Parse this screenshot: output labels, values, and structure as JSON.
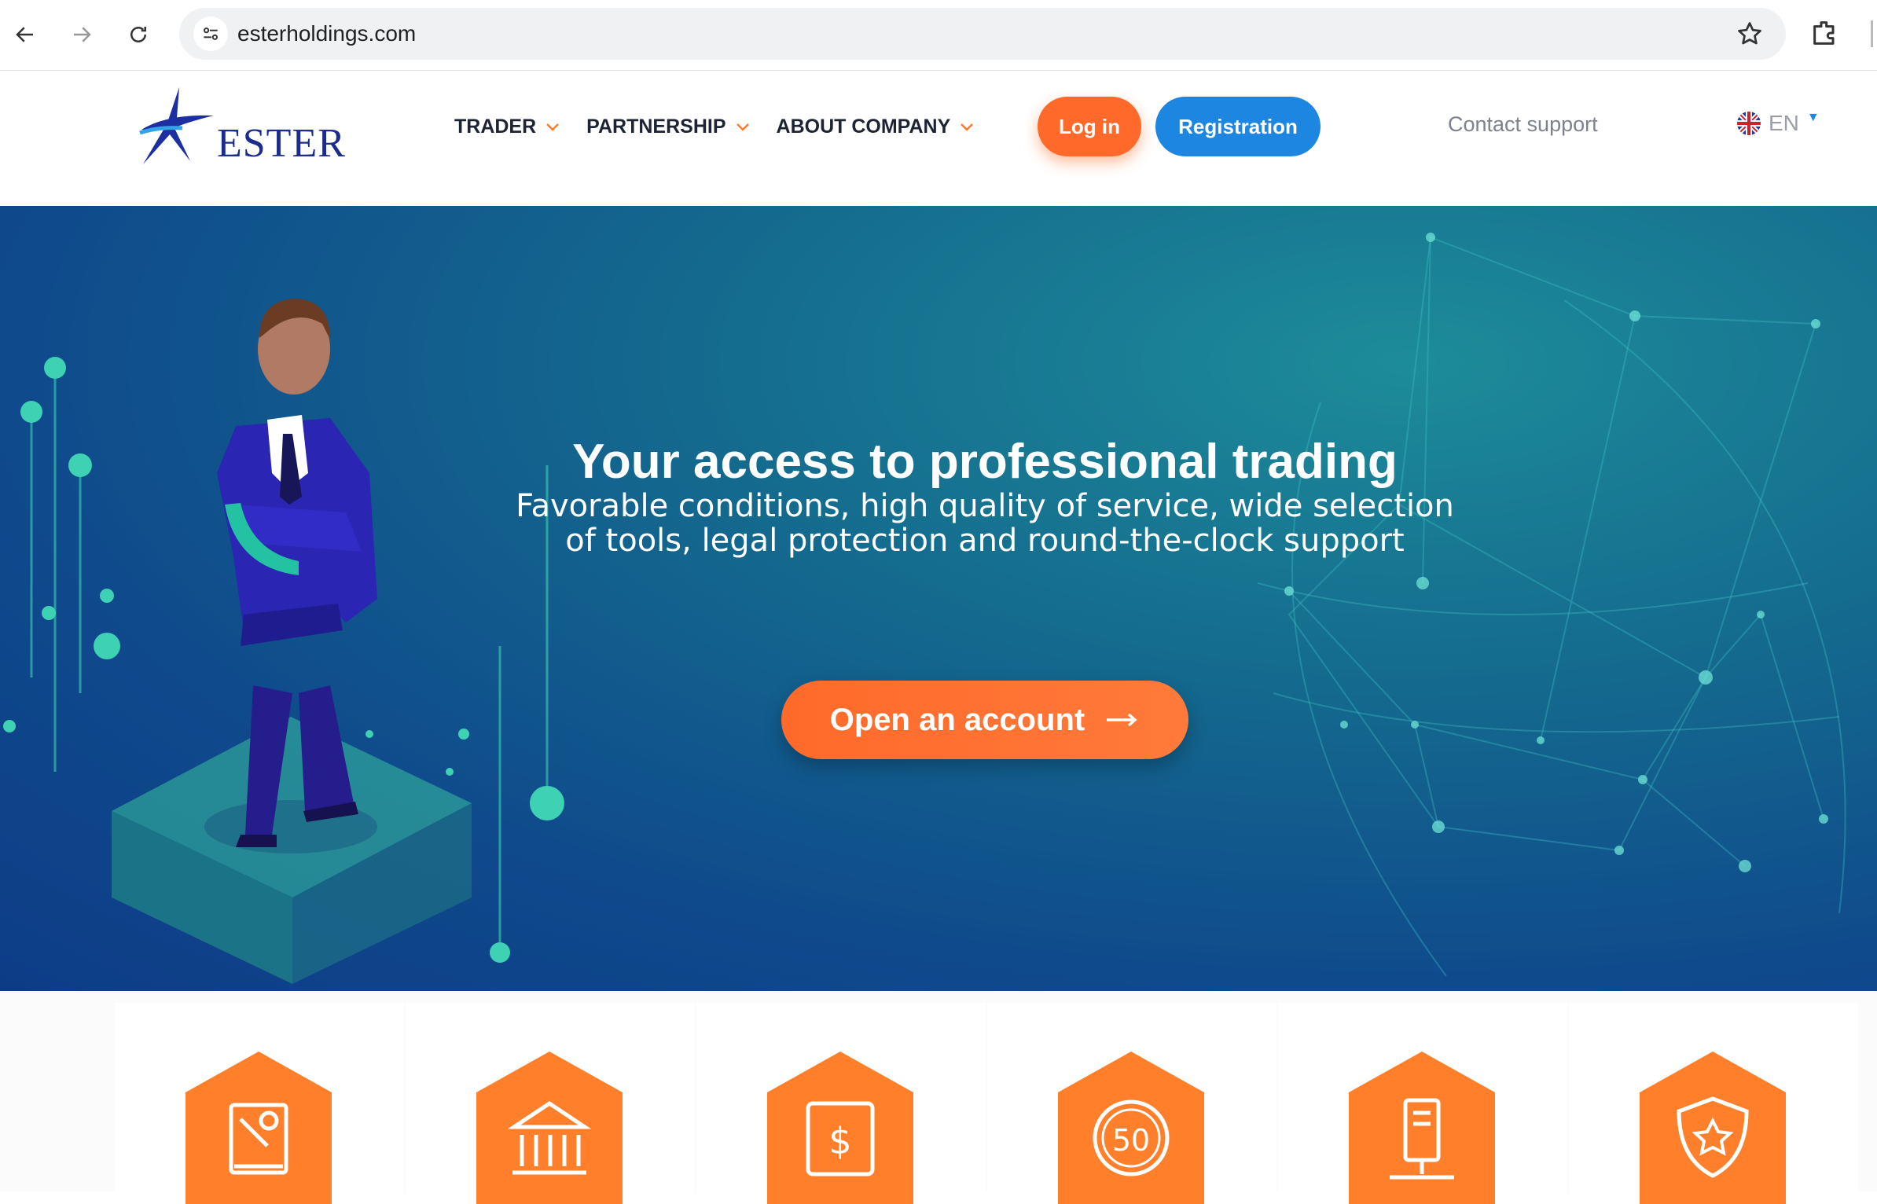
{
  "browser": {
    "url": "esterholdings.com"
  },
  "header": {
    "logo_text": "ESTER",
    "menu": [
      {
        "label": "TRADER"
      },
      {
        "label": "PARTNERSHIP"
      },
      {
        "label": "ABOUT COMPANY"
      }
    ],
    "login_label": "Log in",
    "register_label": "Registration",
    "support_label": "Contact support",
    "language": "EN"
  },
  "hero": {
    "title": "Your access to professional trading",
    "subtitle_line1": "Favorable conditions, high quality of service, wide selection",
    "subtitle_line2": "of tools, legal protection and round-the-clock support",
    "cta_label": "Open an account"
  },
  "features": {
    "icons": [
      "manual-icon",
      "bank-icon",
      "exchange-icon",
      "fifty-icon",
      "server-icon",
      "shield-star-icon"
    ]
  },
  "colors": {
    "accent_orange": "#ff6a2a",
    "accent_blue": "#1d86e0",
    "hex_orange": "#ff7f2a"
  }
}
